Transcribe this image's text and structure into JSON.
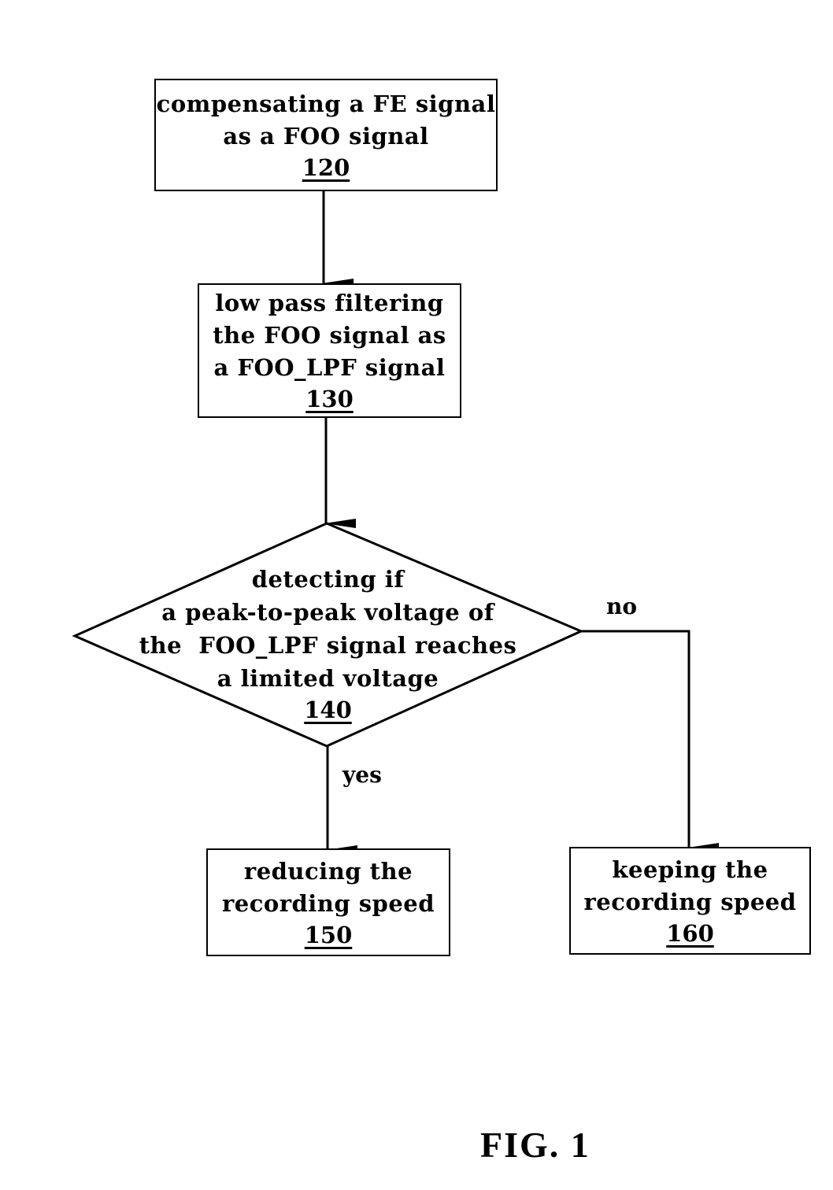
{
  "diagram": {
    "steps": [
      {
        "id": "120",
        "lines": [
          "compensating a FE signal",
          "as a FOO signal"
        ],
        "number": "120"
      },
      {
        "id": "130",
        "lines": [
          "low pass filtering",
          "the FOO signal as",
          "a FOO_LPF signal"
        ],
        "number": "130"
      },
      {
        "id": "140",
        "type": "decision",
        "lines": [
          "detecting if",
          "a peak-to-peak voltage of",
          "the  FOO_LPF signal reaches",
          "a limited voltage"
        ],
        "number": "140"
      },
      {
        "id": "150",
        "lines": [
          "reducing the",
          "recording speed"
        ],
        "number": "150"
      },
      {
        "id": "160",
        "lines": [
          "keeping the",
          "recording speed"
        ],
        "number": "160"
      }
    ],
    "branches": {
      "yes": "yes",
      "no": "no"
    },
    "caption": "FIG. 1"
  }
}
